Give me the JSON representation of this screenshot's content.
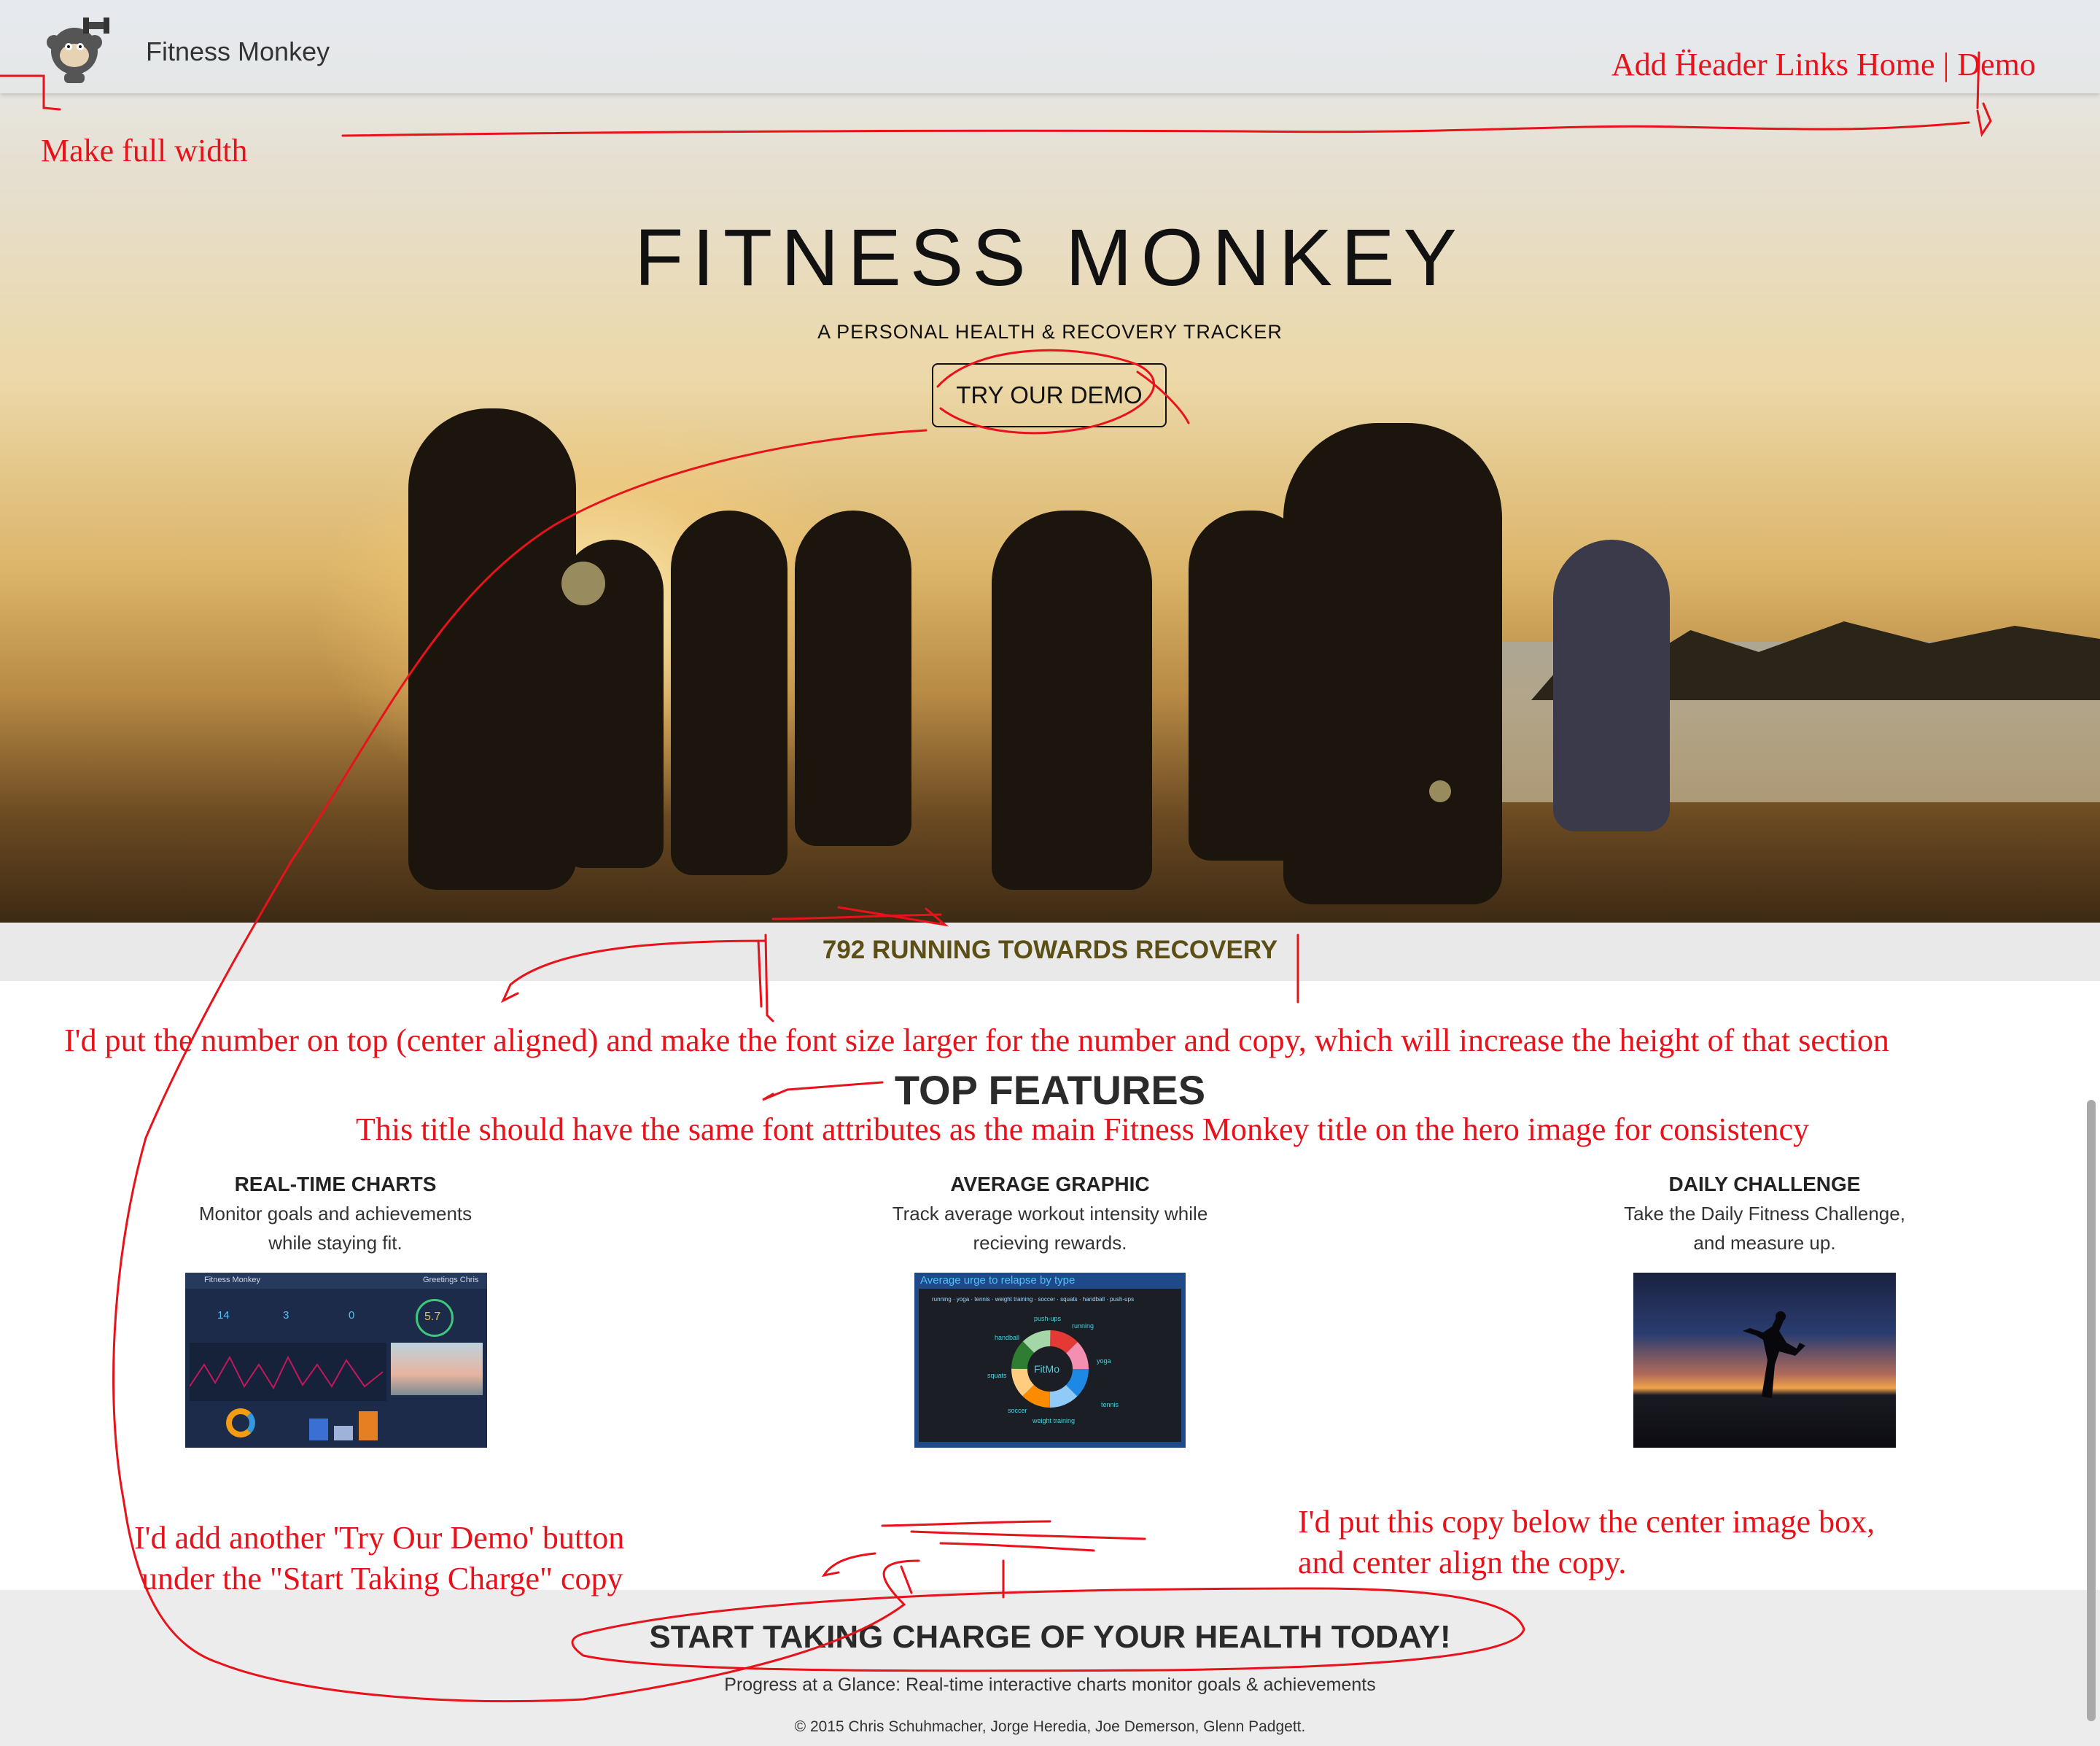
{
  "header": {
    "brand": "Fitness Monkey",
    "logo_icon": "monkey-dumbbell-icon"
  },
  "hero": {
    "title": "FITNESS MONKEY",
    "subtitle": "A PERSONAL HEALTH & RECOVERY TRACKER",
    "cta_label": "TRY OUR DEMO"
  },
  "counter": {
    "text": "792 RUNNING TOWARDS RECOVERY"
  },
  "features": {
    "title": "TOP FEATURES",
    "items": [
      {
        "title": "REAL-TIME CHARTS",
        "description": "Monitor goals and achievements\nwhile staying fit."
      },
      {
        "title": "AVERAGE GRAPHIC",
        "description": "Track average workout intensity while\nrecieving rewards."
      },
      {
        "title": "DAILY CHALLENGE",
        "description": "Take the Daily Fitness Challenge,\nand measure up."
      }
    ],
    "dashboard_shot": {
      "app_name": "Fitness Monkey",
      "greeting": "Greetings Chris",
      "stats": [
        "14",
        "3",
        "0"
      ],
      "gauge": "5.7"
    },
    "donut_shot": {
      "title": "Average urge to relapse by type",
      "legend": [
        "running",
        "yoga",
        "tennis",
        "weight training",
        "soccer",
        "squats",
        "handball",
        "push-ups"
      ],
      "center": "FitMo",
      "labels": [
        "handball",
        "push-ups",
        "running",
        "yoga",
        "squats",
        "tennis",
        "soccer",
        "weight training"
      ]
    }
  },
  "cta": {
    "title": "START TAKING CHARGE OF YOUR HEALTH TODAY!",
    "subtitle": "Progress at a Glance: Real-time interactive charts monitor goals & achievements",
    "copyright": "© 2015 Chris Schuhmacher, Jorge Heredia, Joe Demerson, Glenn Padgett."
  },
  "annotations": {
    "header_links": "Add Ḧeader Links Home | Demo",
    "full_width": "Make full width",
    "counter_note": "I'd put the number on top (center aligned) and make the font size larger for the number and copy, which will increase the height of that section",
    "title_note": "This title should have the same font attributes as the main Fitness Monkey title on the hero image for consistency",
    "demo_note_1": "I'd add another 'Try Our Demo' button",
    "demo_note_2": "under the \"Start Taking Charge\" copy",
    "copy_note_1": "I'd put this copy below the center image box,",
    "copy_note_2": "and center align the copy."
  },
  "colors": {
    "annotation": "#e8121b",
    "counter_text": "#5c4f16",
    "band_gray": "#e9e9e9"
  }
}
